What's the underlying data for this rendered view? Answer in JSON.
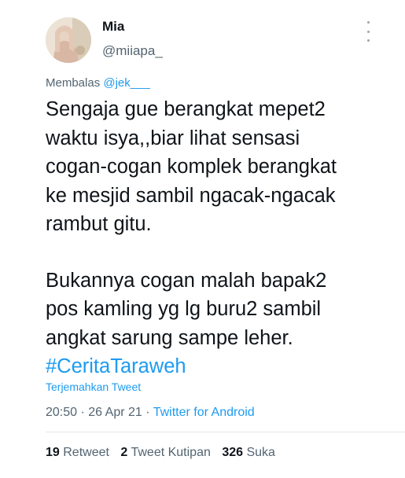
{
  "user": {
    "name": "Mia",
    "handle": "@miiapa_"
  },
  "reply": {
    "prefix": "Membalas",
    "to": "@jek___"
  },
  "tweet": {
    "lines_p1": [
      "Sengaja gue berangkat mepet2",
      "waktu isya,,biar lihat sensasi",
      "cogan-cogan komplek berangkat",
      "ke mesjid sambil ngacak-ngacak",
      "rambut gitu."
    ],
    "lines_p2": [
      "Bukannya cogan malah bapak2",
      "pos kamling yg lg buru2 sambil",
      "angkat sarung sampe leher."
    ],
    "hashtag": "#CeritaTaraweh"
  },
  "translate_label": "Terjemahkan Tweet",
  "meta": {
    "time": "20:50",
    "sep": "·",
    "date": "26 Apr 21",
    "source": "Twitter for Android"
  },
  "stats": {
    "retweets": "19",
    "retweets_label": "Retweet",
    "quotes": "2",
    "quotes_label": "Tweet Kutipan",
    "likes": "326",
    "likes_label": "Suka"
  },
  "icons": {
    "more": "more-vertical-icon"
  },
  "colors": {
    "link": "#1d9bf0",
    "secondary": "#536471",
    "text": "#0f1419"
  }
}
